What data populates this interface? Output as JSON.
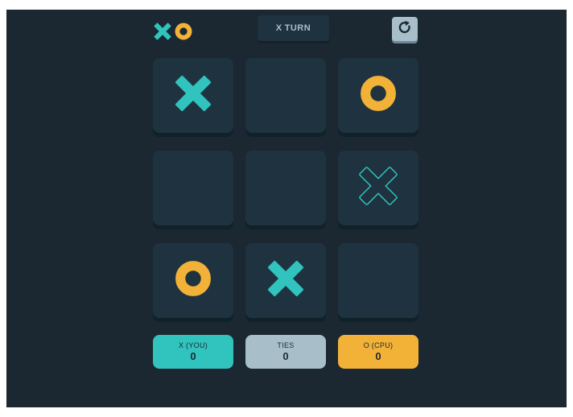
{
  "header": {
    "logo_icons": [
      "x-mark-icon",
      "o-mark-icon"
    ],
    "turn_mark": "X",
    "turn_text": "TURN",
    "restart_icon": "restart-icon"
  },
  "board": {
    "cells": [
      {
        "mark": "X",
        "state": "placed"
      },
      {
        "mark": "",
        "state": "empty"
      },
      {
        "mark": "O",
        "state": "placed"
      },
      {
        "mark": "",
        "state": "empty"
      },
      {
        "mark": "",
        "state": "empty"
      },
      {
        "mark": "X",
        "state": "hover-preview"
      },
      {
        "mark": "O",
        "state": "placed"
      },
      {
        "mark": "X",
        "state": "placed"
      },
      {
        "mark": "",
        "state": "empty"
      }
    ]
  },
  "scores": {
    "x": {
      "label": "X (YOU)",
      "value": "0"
    },
    "ties": {
      "label": "TIES",
      "value": "0"
    },
    "o": {
      "label": "O (CPU)",
      "value": "0"
    }
  },
  "colors": {
    "background": "#1b2731",
    "tile": "#1f3240",
    "x_color": "#31c3bd",
    "o_color": "#f2b137",
    "ties_color": "#a8bfc9"
  }
}
